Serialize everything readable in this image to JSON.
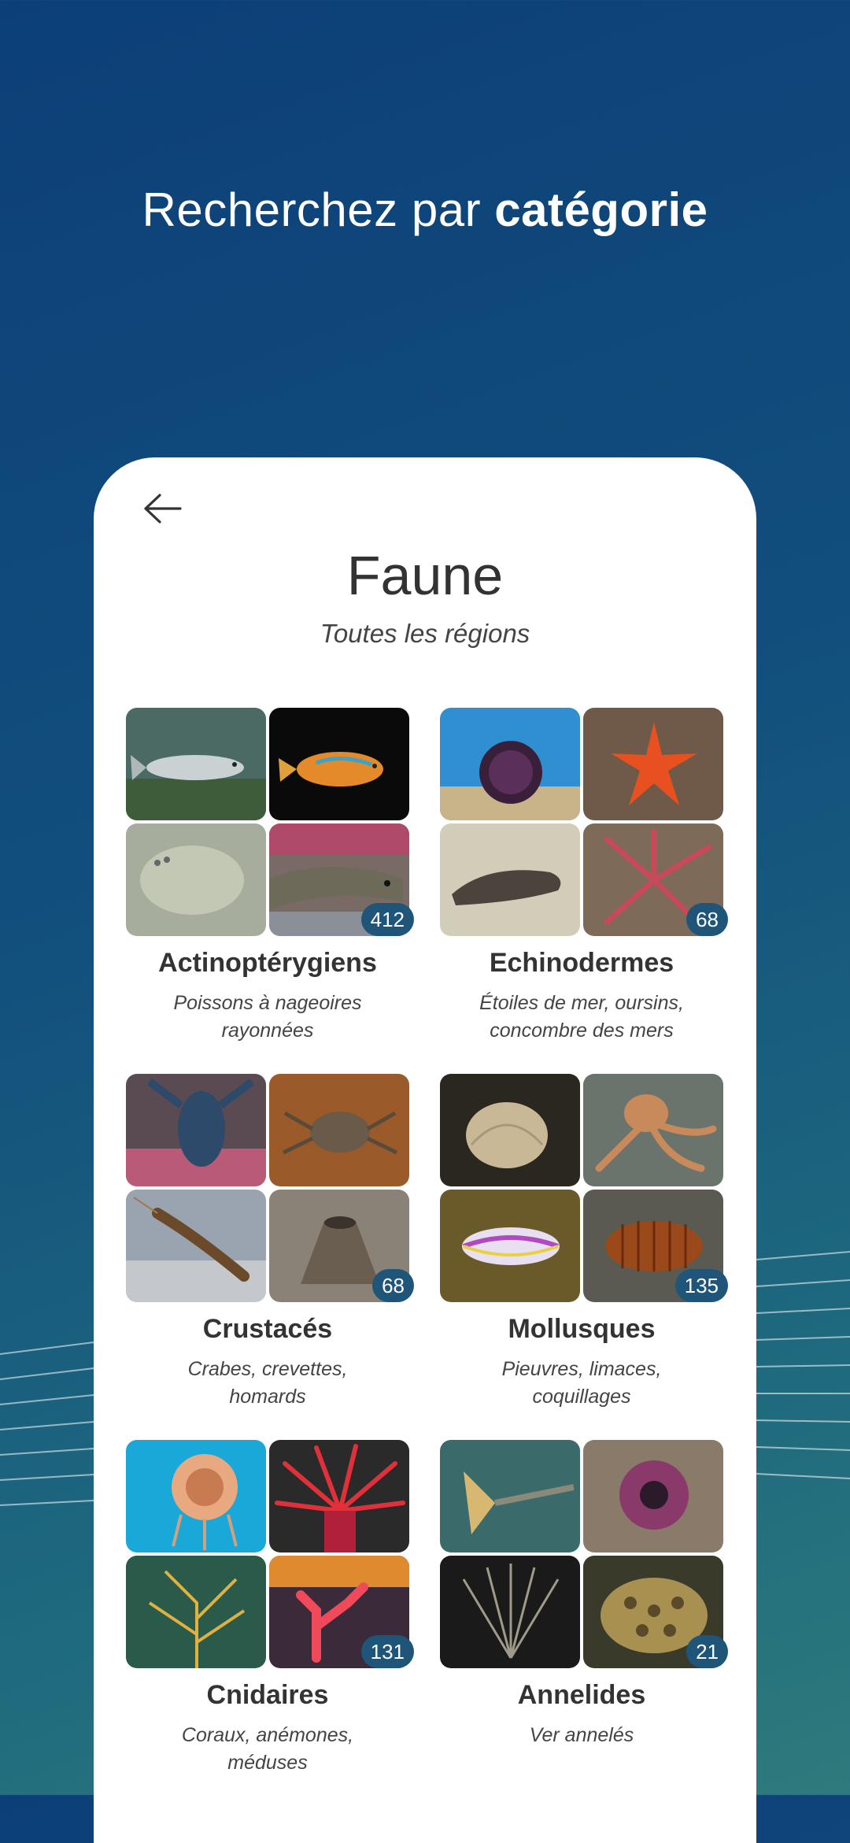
{
  "headline": {
    "prefix": "Recherchez par ",
    "bold": "catégorie"
  },
  "screen": {
    "title": "Faune",
    "subtitle": "Toutes les régions",
    "categories": [
      {
        "name": "Actinoptérygiens",
        "description": "Poissons à nageoires\nrayonnées",
        "count": "412",
        "thumbnails": [
          "fish-sea-bass",
          "fish-wrasse",
          "fish-flatfish",
          "fish-moray-eel"
        ]
      },
      {
        "name": "Echinodermes",
        "description": "Étoiles de mer, oursins,\nconcombre des mers",
        "count": "68",
        "thumbnails": [
          "sea-urchin",
          "starfish-red",
          "sea-cucumber",
          "brittle-star"
        ]
      },
      {
        "name": "Crustacés",
        "description": "Crabes, crevettes,\nhomards",
        "count": "68",
        "thumbnails": [
          "lobster",
          "crab",
          "shrimp",
          "barnacle"
        ]
      },
      {
        "name": "Mollusques",
        "description": "Pieuvres, limaces,\ncoquillages",
        "count": "135",
        "thumbnails": [
          "shell-clam",
          "octopus",
          "nudibranch",
          "chiton"
        ]
      },
      {
        "name": "Cnidaires",
        "description": "Coraux, anémones,\nméduses",
        "count": "131",
        "thumbnails": [
          "jellyfish",
          "sea-anemone-red",
          "gorgonian-coral",
          "red-coral"
        ]
      },
      {
        "name": "Annelides",
        "description": "Ver annelés",
        "count": "21",
        "thumbnails": [
          "fan-worm-yellow",
          "tube-anemone",
          "peacock-worm",
          "reef-sponge"
        ]
      }
    ]
  },
  "colors": {
    "badge": "#1f5578",
    "background_top": "#0c3f78",
    "background_bottom": "#2e7a7c"
  },
  "icons": {
    "back": "arrow-left-icon"
  }
}
